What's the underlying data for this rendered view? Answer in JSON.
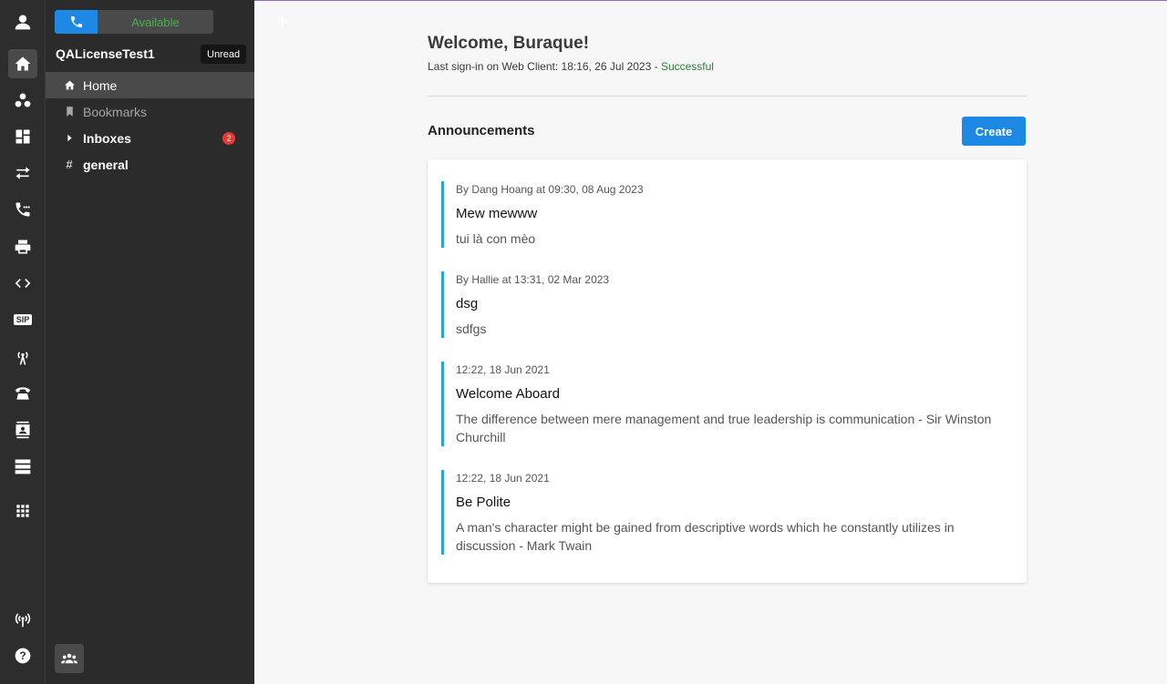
{
  "rail": {
    "icons": [
      "user-icon",
      "home-icon",
      "groups-icon",
      "dashboard-icon",
      "transfer-icon",
      "call-flow-icon",
      "printer-icon",
      "code-icon",
      "sip-icon",
      "antenna-icon",
      "desk-phone-icon",
      "contacts-icon",
      "servers-icon",
      "apps-grid-icon",
      "broadcast-icon",
      "help-icon"
    ],
    "sip_label": "SIP"
  },
  "sidebar": {
    "availability": "Available",
    "workspace_name": "QALicenseTest1",
    "unread_label": "Unread",
    "items": [
      {
        "label": "Home"
      },
      {
        "label": "Bookmarks"
      },
      {
        "label": "Inboxes",
        "badge": "2"
      },
      {
        "label": "general"
      }
    ]
  },
  "main": {
    "welcome": "Welcome, Buraque!",
    "last_signin_prefix": "Last sign-in on Web Client: 18:16, 26 Jul 2023 - ",
    "last_signin_status": "Successful",
    "announcements_title": "Announcements",
    "create_label": "Create",
    "announcements": [
      {
        "meta": "By Dang Hoang at 09:30, 08 Aug 2023",
        "title": "Mew mewww",
        "body": "tui là con mèo"
      },
      {
        "meta": "By Hallie at 13:31, 02 Mar 2023",
        "title": "dsg",
        "body": "sdfgs"
      },
      {
        "meta": "12:22, 18 Jun 2021",
        "title": "Welcome Aboard",
        "body": "The difference between mere management and true leadership is communication - Sir Winston Churchill"
      },
      {
        "meta": "12:22, 18 Jun 2021",
        "title": "Be Polite",
        "body": "A man's character might be gained from descriptive words which he constantly utilizes in discussion - Mark Twain"
      }
    ]
  },
  "colors": {
    "accent": "#1e88e5",
    "available": "#4caf50",
    "success": "#2e7d32",
    "badge": "#e53935",
    "announcement_border": "#29a3d9"
  }
}
